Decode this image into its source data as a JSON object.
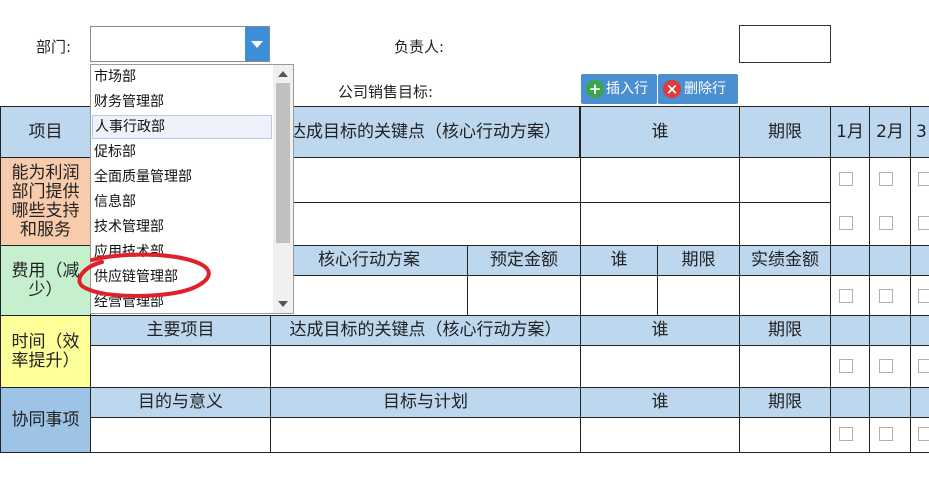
{
  "form": {
    "dept_label": "部门:",
    "owner_label": "负责人:",
    "target_label": "公司销售目标:",
    "insert_row": "插入行",
    "delete_row": "删除行"
  },
  "dropdown": {
    "value": "",
    "options": [
      "市场部",
      "财务管理部",
      "人事行政部",
      "促标部",
      "全面质量管理部",
      "信息部",
      "技术管理部",
      "应用技术部",
      "供应链管理部",
      "经营管理部"
    ],
    "highlighted": "人事行政部",
    "circled": "供应链管理部"
  },
  "table": {
    "header": {
      "item": "项目",
      "keypoint": "达成目标的关键点（核心行动方案）",
      "who": "谁",
      "deadline": "期限",
      "m1": "1月",
      "m2": "2月",
      "m3": "3"
    },
    "profit_label": "能为利润部门提供哪些支持和服务",
    "cost_label": "费用（减少）",
    "cost_header": {
      "plan": "核心行动方案",
      "budget": "预定金额",
      "who": "谁",
      "deadline": "期限",
      "actual": "实绩金额"
    },
    "time_label": "时间（效率提升）",
    "time_header": {
      "main": "主要项目",
      "keypoint": "达成目标的关键点（核心行动方案）",
      "who": "谁",
      "deadline": "期限"
    },
    "coop_label": "协同事项",
    "coop_header": {
      "purpose": "目的与意义",
      "plan": "目标与计划",
      "who": "谁",
      "deadline": "期限"
    }
  },
  "colors": {
    "accent": "#4a8fd2",
    "header_blue": "#bdd7ee",
    "orange": "#f8cbad",
    "green": "#c6efce",
    "yellow": "#ffff99",
    "light_blue": "#9dc3e6",
    "circle_red": "#e0202a"
  }
}
